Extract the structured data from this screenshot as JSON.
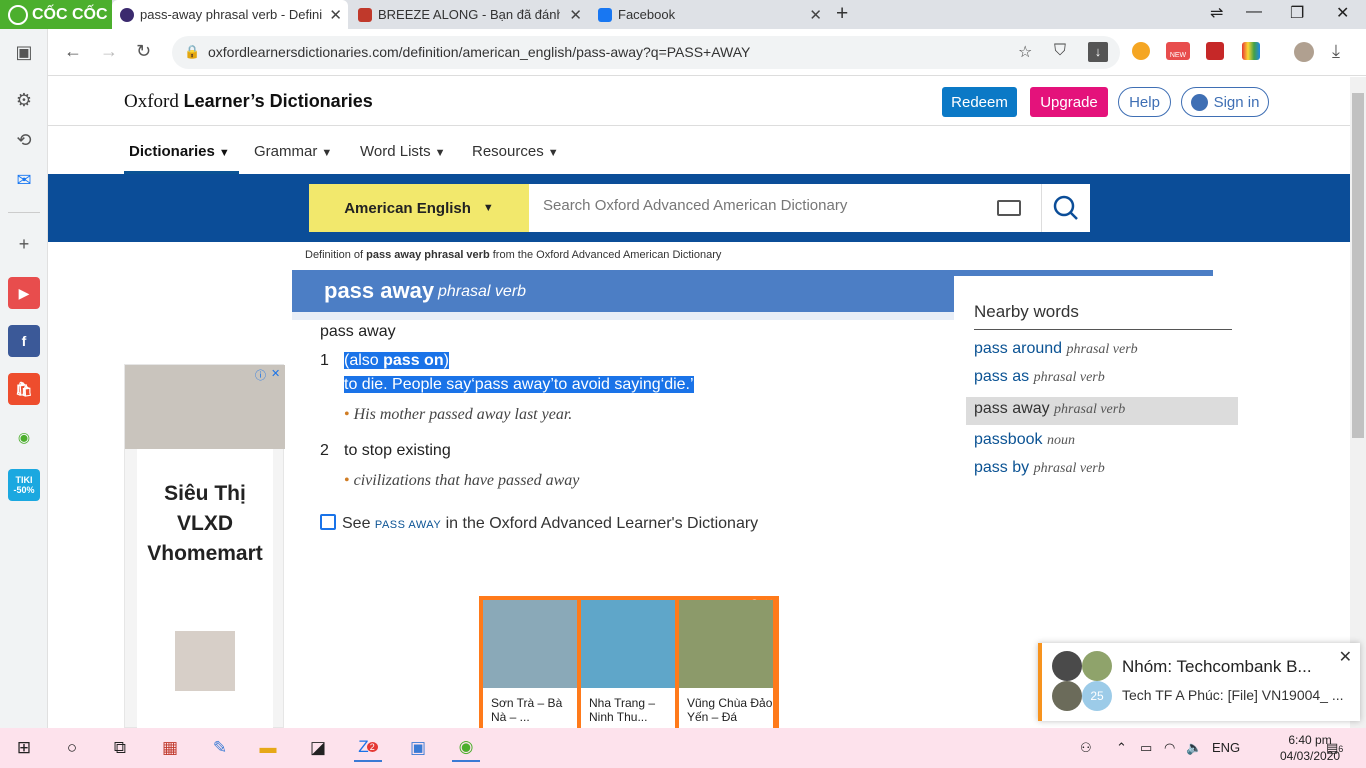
{
  "browser": {
    "brand": "CỐC CỐC",
    "tabs": [
      {
        "title": "pass-away phrasal verb - Definition",
        "active": true
      },
      {
        "title": "BREEZE ALONG - Bạn đã đánh",
        "active": false
      },
      {
        "title": "Facebook",
        "active": false
      }
    ],
    "url": "oxfordlearnersdictionaries.com/definition/american_english/pass-away?q=PASS+AWAY",
    "ext_badge": "NEW"
  },
  "sidebar": {
    "apps": [
      "youtube",
      "facebook",
      "shopee",
      "coccoc",
      "tiki"
    ],
    "tiki_label": "TIKI",
    "tiki_discount": "-50%"
  },
  "site": {
    "logo_light": "Oxford",
    "logo_bold": "Learner’s Dictionaries",
    "redeem": "Redeem",
    "upgrade": "Upgrade",
    "help": "Help",
    "signin": "Sign in",
    "nav": [
      "Dictionaries",
      "Grammar",
      "Word Lists",
      "Resources"
    ],
    "dict_select": "American English",
    "search_placeholder": "Search Oxford Advanced American Dictionary"
  },
  "entry": {
    "crumb_pre": "Definition of ",
    "crumb_bold": "pass away phrasal verb",
    "crumb_post": " from the Oxford Advanced American Dictionary",
    "headword": "pass away",
    "pos": "phrasal verb",
    "phrase": "pass away",
    "senses": [
      {
        "num": "1",
        "also_pre": "(also ",
        "also_bold": "pass on",
        "also_post": ")",
        "def": "to die. People say‘pass away’to avoid saying‘die.’",
        "example": "His mother passed away last year."
      },
      {
        "num": "2",
        "def": "to stop existing",
        "example": "civilizations that have passed away"
      }
    ],
    "see_pre": "See ",
    "see_sc": "PASS AWAY",
    "see_post": " in the Oxford Advanced Learner's Dictionary"
  },
  "nearby": {
    "title": "Nearby words",
    "items": [
      {
        "word": "pass around",
        "pos": "phrasal verb"
      },
      {
        "word": "pass as",
        "pos": "phrasal verb"
      },
      {
        "word": "pass away",
        "pos": "phrasal verb"
      },
      {
        "word": "passbook",
        "pos": "noun"
      },
      {
        "word": "pass by",
        "pos": "phrasal verb"
      }
    ]
  },
  "ads": {
    "left_title": "Siêu Thị VLXD Vhomemart",
    "tiles": [
      {
        "caption": "Sơn Trà – Bà Nà – ..."
      },
      {
        "caption": "Nha Trang – Ninh Thu..."
      },
      {
        "caption": "Vũng Chùa Đảo Yến – Đá"
      }
    ]
  },
  "notification": {
    "title": "Nhóm: Techcombank B...",
    "message": "Tech TF A Phúc: [File] VN19004_ ...",
    "avatar_count": "25"
  },
  "taskbar": {
    "zalo_badge": "2",
    "lang": "ENG",
    "time": "6:40 pm",
    "date": "04/03/2020",
    "notif_count": "6"
  },
  "colors": {
    "brand_green": "#4caf2d",
    "oxford_blue": "#0b4d98",
    "entry_blue": "#4c7ec5",
    "redeem": "#0b79c6",
    "upgrade": "#e4127b",
    "dict_yellow": "#f2e86c",
    "selection": "#1a73e8"
  }
}
